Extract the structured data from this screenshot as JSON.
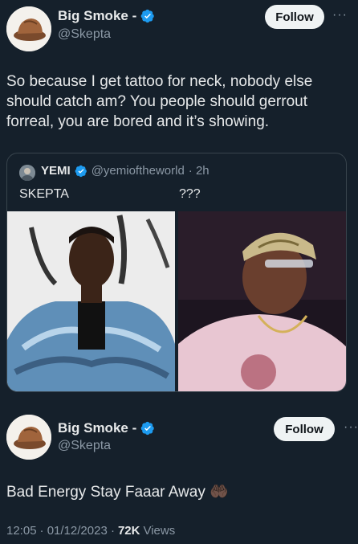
{
  "tweet1": {
    "display_name": "Big Smoke -",
    "handle": "@Skepta",
    "follow_label": "Follow",
    "more_label": "···",
    "text": "So because I get tattoo for neck, nobody else should catch am? You people should gerrout forreal, you are bored and it’s showing.",
    "quote": {
      "name": "YEMI",
      "handle": "@yemioftheworld",
      "time": "· 2h",
      "left_caption": "SKEPTA",
      "right_caption": "???"
    }
  },
  "tweet2": {
    "display_name": "Big Smoke -",
    "handle": "@Skepta",
    "follow_label": "Follow",
    "more_label": "···",
    "text": "Bad Energy Stay Faaar Away",
    "emoji": "🤲🏿",
    "time": "12:05",
    "date": "· 01/12/2023 ·",
    "views_count": "72K",
    "views_label": "Views"
  },
  "colors": {
    "background": "#15202b",
    "verified": "#1d9bf0",
    "muted": "#8b98a5"
  },
  "icons": [
    "verified-badge-icon",
    "more-options-icon"
  ]
}
